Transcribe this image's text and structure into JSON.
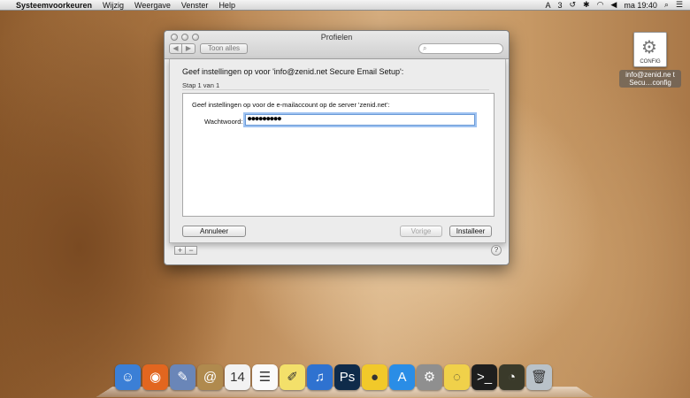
{
  "menubar": {
    "apple_glyph": "",
    "app_name": "Systeemvoorkeuren",
    "items": [
      "Wijzig",
      "Weergave",
      "Venster",
      "Help"
    ],
    "status": {
      "adobe_count": "3",
      "clock": "ma 19:40"
    }
  },
  "desktop_file": {
    "tag": "CONFIG",
    "label": "info@zenid.ne t Secu…config"
  },
  "window": {
    "title": "Profielen",
    "show_all_label": "Toon alles",
    "back_glyph": "◀",
    "forward_glyph": "▶",
    "search_glyph": "⌕"
  },
  "sheet": {
    "title": "Geef instellingen op voor 'info@zenid.net Secure Email Setup':",
    "step": "Stap 1 van 1",
    "panel_text": "Geef instellingen op voor de e-mailaccount op de server 'zenid.net':",
    "password_label": "Wachtwoord:",
    "password_value": "●●●●●●●●●",
    "cancel_label": "Annuleer",
    "previous_label": "Vorige",
    "install_label": "Installeer"
  },
  "window_footer": {
    "add_glyph": "+",
    "remove_glyph": "−",
    "help_glyph": "?"
  },
  "dock": {
    "icons": [
      {
        "name": "finder-icon",
        "glyph": "☺",
        "color": "#3b7fd6"
      },
      {
        "name": "firefox-icon",
        "glyph": "◉",
        "color": "#e2661f"
      },
      {
        "name": "preview-icon",
        "glyph": "✎",
        "color": "#6a86b8"
      },
      {
        "name": "contacts-icon",
        "glyph": "@",
        "color": "#b08a4e"
      },
      {
        "name": "calendar-icon",
        "glyph": "14",
        "color": "#f2f2f2"
      },
      {
        "name": "reminders-icon",
        "glyph": "☰",
        "color": "#fafafa"
      },
      {
        "name": "notes-icon",
        "glyph": "✐",
        "color": "#f3e06a"
      },
      {
        "name": "itunes-icon",
        "glyph": "♫",
        "color": "#2f72d0"
      },
      {
        "name": "photoshop-icon",
        "glyph": "Ps",
        "color": "#0f2b4a"
      },
      {
        "name": "cyberduck-icon",
        "glyph": "●",
        "color": "#f1c92a"
      },
      {
        "name": "app-store-icon",
        "glyph": "A",
        "color": "#2a8de6"
      },
      {
        "name": "system-preferences-icon",
        "glyph": "⚙",
        "color": "#8f8f8f"
      },
      {
        "name": "adium-icon",
        "glyph": "◌",
        "color": "#f0d14a"
      },
      {
        "name": "terminal-icon",
        "glyph": ">_",
        "color": "#1e1e1e"
      },
      {
        "name": "radar-icon",
        "glyph": "◔",
        "color": "#3a3a2a"
      },
      {
        "name": "trash-icon",
        "glyph": "🗑",
        "color": "#b9c2c9"
      }
    ]
  }
}
